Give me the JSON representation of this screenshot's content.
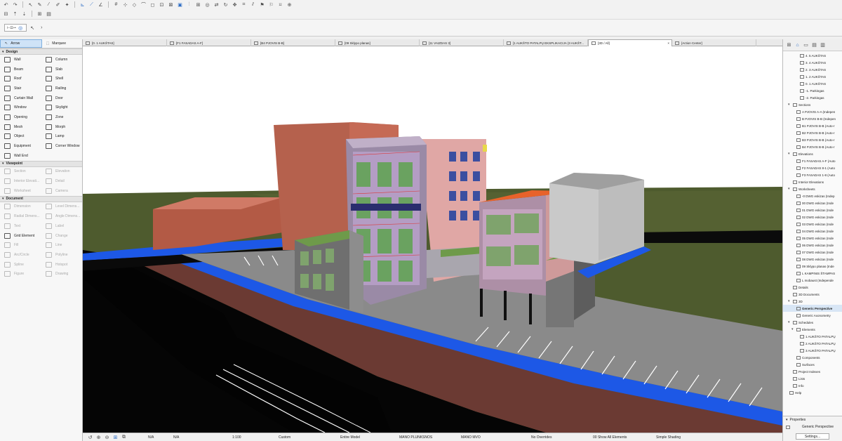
{
  "toolbox": {
    "arrow": "Arrow",
    "marquee": "Marquee",
    "groups": {
      "design": "Design",
      "viewpoint": "Viewpoint",
      "document": "Document"
    },
    "design_tools": [
      "Wall",
      "Column",
      "Beam",
      "Slab",
      "Roof",
      "Shell",
      "Stair",
      "Railing",
      "Curtain Wall",
      "Door",
      "Window",
      "Skylight",
      "Opening",
      "Zone",
      "Mesh",
      "Morph",
      "Object",
      "Lamp",
      "Equipment",
      "Corner Window",
      "Wall End",
      ""
    ],
    "viewpoint_tools": [
      "Section",
      "Elevation",
      "Interior Elevati...",
      "Detail",
      "Worksheet",
      "Camera"
    ],
    "document_tools": [
      "Dimension",
      "Level Dimens...",
      "Radial Dimens...",
      "Angle Dimens...",
      "Text",
      "Label",
      "Grid Element",
      "Change",
      "Fill",
      "Line",
      "Arc/Circle",
      "Polyline",
      "Spline",
      "Hotspot",
      "Figure",
      "Drawing"
    ]
  },
  "tabs": [
    {
      "label": "[0. 1 AUKŠTAS]"
    },
    {
      "label": "[F1 FASADAS A-F]"
    },
    {
      "label": "[B4 PJOVIS B-B]"
    },
    {
      "label": "[09 Sklypo planas]"
    },
    {
      "label": "[11 VAIZDAS 3]"
    },
    {
      "label": "[1 AUKŠTO PATALPŲ EKSPLIKACIJA (3 AUKŠT..."
    },
    {
      "label": "[3D / All]"
    },
    {
      "label": "[Action Center]"
    }
  ],
  "status": {
    "na1": "N/A",
    "na2": "N/A",
    "scale": "1:100",
    "layer": "Custom",
    "model": "Entire Model",
    "pen1": "MANO PLUNKSNOS",
    "mvo": "MANO MVO",
    "overrides": "No Overrides",
    "renovation": "00 Show All Elements",
    "shading": "Simple Shading"
  },
  "navigator": {
    "items": [
      {
        "label": "4. 5 AUKŠTAS",
        "level": 3
      },
      {
        "label": "3. 4 AUKŠTAS",
        "level": 3
      },
      {
        "label": "2. 3 AUKŠTAS",
        "level": 3
      },
      {
        "label": "1. 2 AUKŠTAS",
        "level": 3
      },
      {
        "label": "0. 1 AUKŠTAS",
        "level": 3
      },
      {
        "label": "-1. Parkingas",
        "level": 3
      },
      {
        "label": "-2. Parkingas",
        "level": 3
      },
      {
        "label": "Sections",
        "level": 1,
        "folder": true
      },
      {
        "label": "A PJOVIS A-A (Indepen",
        "level": 2
      },
      {
        "label": "B PJOVIS B-B (Indepen",
        "level": 2
      },
      {
        "label": "B1 PJOVIS B-B (Auto-r",
        "level": 2
      },
      {
        "label": "B2 PJOVIS B-B (Auto-r",
        "level": 2
      },
      {
        "label": "B3 PJOVIS B-B (Auto-r",
        "level": 2
      },
      {
        "label": "B4 PJOVIS B-B (Auto-r",
        "level": 2
      },
      {
        "label": "Elevations",
        "level": 1,
        "folder": true
      },
      {
        "label": "F1 FASADAS A-F (Auto",
        "level": 2
      },
      {
        "label": "F2 FASADAS 8-1 (Auto",
        "level": 2
      },
      {
        "label": "F3 FASADAS 1-8 (Auto",
        "level": 2
      },
      {
        "label": "Interior Elevations",
        "level": 1
      },
      {
        "label": "Worksheets",
        "level": 1,
        "folder": true
      },
      {
        "label": "-0 DWG eskizas (Indep",
        "level": 2
      },
      {
        "label": "00 DWG eskizas (Inde",
        "level": 2
      },
      {
        "label": "01 DWG eskizas (Inde",
        "level": 2
      },
      {
        "label": "02 DWG eskizas (Inde",
        "level": 2
      },
      {
        "label": "03 DWG eskizas (Inde",
        "level": 2
      },
      {
        "label": "04 DWG eskizas (Inde",
        "level": 2
      },
      {
        "label": "05 DWG eskizas (Inde",
        "level": 2
      },
      {
        "label": "06 DWG eskizas (Inde",
        "level": 2
      },
      {
        "label": "07 DWG eskizas (Inde",
        "level": 2
      },
      {
        "label": "08 DWG eskizas (Inde",
        "level": 2
      },
      {
        "label": "09 Sklypo planas (Inde",
        "level": 2
      },
      {
        "label": "L KAMPINIS ŠTAMPAS",
        "level": 2
      },
      {
        "label": "L mobaust (Independe",
        "level": 2
      },
      {
        "label": "Details",
        "level": 1
      },
      {
        "label": "3D Documents",
        "level": 1
      },
      {
        "label": "3D",
        "level": 1,
        "folder": true
      },
      {
        "label": "Generic Perspective",
        "level": 2,
        "selected": true
      },
      {
        "label": "Generic Axonometry",
        "level": 2
      },
      {
        "label": "Schedules",
        "level": 1,
        "folder": true
      },
      {
        "label": "Elements",
        "level": 2,
        "folder": true
      },
      {
        "label": "1 AUKŠTO PATALPŲ",
        "level": 3
      },
      {
        "label": "2 AUKŠTO PATALPŲ",
        "level": 3
      },
      {
        "label": "3 AUKŠTO PATALPŲ",
        "level": 3
      },
      {
        "label": "Components",
        "level": 2
      },
      {
        "label": "Surfaces",
        "level": 2
      },
      {
        "label": "Project Indexes",
        "level": 1
      },
      {
        "label": "Lists",
        "level": 1
      },
      {
        "label": "Info",
        "level": 1
      },
      {
        "label": "Help",
        "level": 0
      }
    ],
    "properties_header": "Properties",
    "properties_view": "Generic Perspective",
    "settings_button": "Settings..."
  },
  "colors": {
    "accent": "#2b6cc4",
    "grass": "#4e5b2e",
    "road": "#050505",
    "curb_blue": "#1d58e6",
    "sidewalk_red": "#7a3e36",
    "parking": "#8a8a8a"
  }
}
